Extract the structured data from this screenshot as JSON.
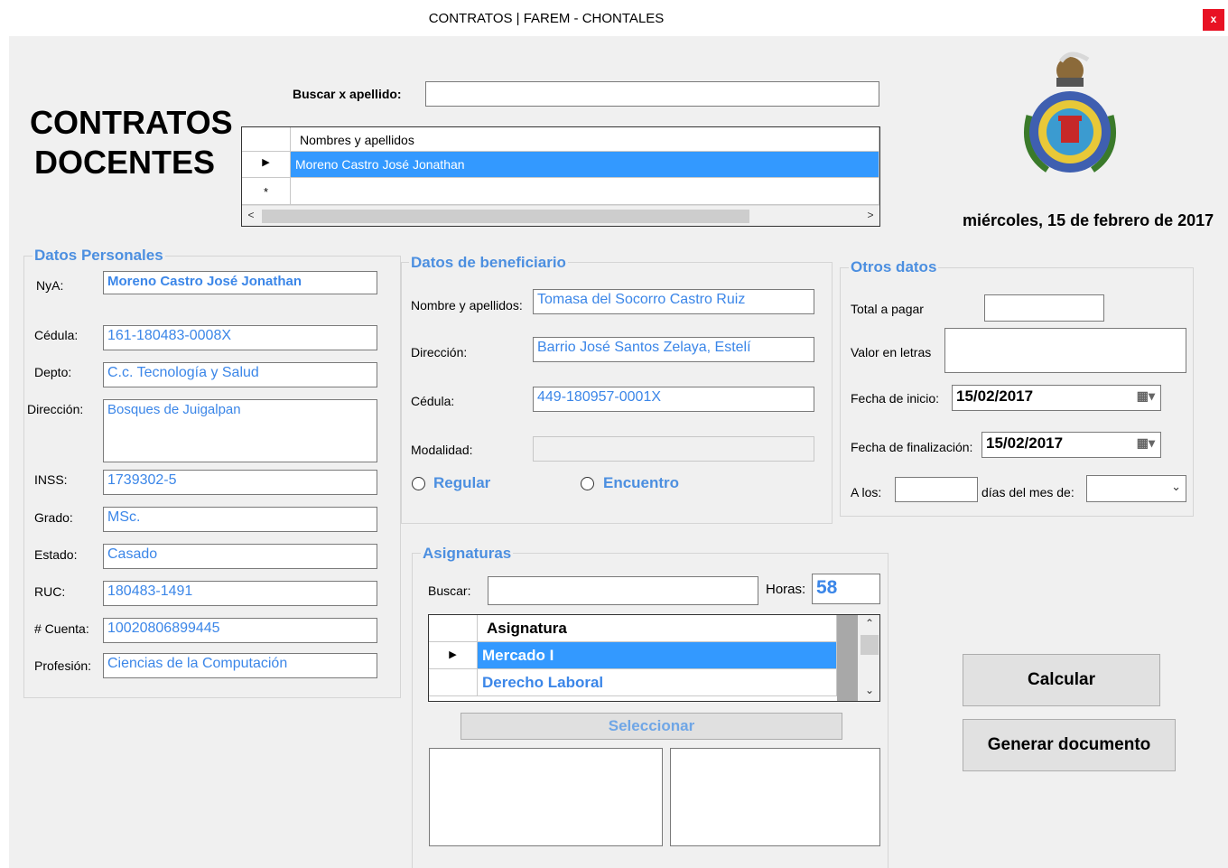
{
  "window": {
    "title": "CONTRATOS |  FAREM - CHONTALES",
    "close_label": "x"
  },
  "header": {
    "title_line1": "CONTRATOS",
    "title_line2": "DOCENTES",
    "date": "miércoles, 15 de febrero de 2017"
  },
  "search": {
    "label": "Buscar x apellido:",
    "value": ""
  },
  "results_grid": {
    "column": "Nombres y apellidos",
    "rows": [
      "Moreno Castro José Jonathan"
    ],
    "new_row_marker": "*",
    "scroll_left": "<",
    "scroll_right": ">"
  },
  "personal": {
    "legend": "Datos Personales",
    "fields": [
      {
        "label": "NyA:",
        "value": "Moreno Castro José Jonathan"
      },
      {
        "label": "Cédula:",
        "value": "161-180483-0008X"
      },
      {
        "label": "Depto:",
        "value": "C.c. Tecnología y Salud"
      },
      {
        "label": "Dirección:",
        "value": "Bosques de Juigalpan"
      },
      {
        "label": "INSS:",
        "value": "1739302-5"
      },
      {
        "label": "Grado:",
        "value": "MSc."
      },
      {
        "label": "Estado:",
        "value": "Casado"
      },
      {
        "label": "RUC:",
        "value": "180483-1491"
      },
      {
        "label": "# Cuenta:",
        "value": "10020806899445"
      },
      {
        "label": "Profesión:",
        "value": "Ciencias de la Computación"
      }
    ]
  },
  "beneficiary": {
    "legend": "Datos de beneficiario",
    "fields": [
      {
        "label": "Nombre y apellidos:",
        "value": "Tomasa del Socorro Castro Ruiz"
      },
      {
        "label": "Dirección:",
        "value": "Barrio José Santos Zelaya, Estelí"
      },
      {
        "label": "Cédula:",
        "value": "449-180957-0001X"
      },
      {
        "label": "Modalidad:",
        "value": ""
      }
    ],
    "radio_regular": "Regular",
    "radio_encuentro": "Encuentro"
  },
  "other": {
    "legend": "Otros datos",
    "total_label": "Total a pagar",
    "total_value": "",
    "letters_label": "Valor en letras",
    "letters_value": "",
    "start_label": "Fecha de inicio:",
    "start_value": "15/02/2017",
    "end_label": "Fecha de finalización:",
    "end_value": "15/02/2017",
    "alos_label": "A los:",
    "alos_value": "",
    "month_label": "días del mes de:",
    "month_value": ""
  },
  "subjects": {
    "legend": "Asignaturas",
    "search_label": "Buscar:",
    "search_value": "",
    "hours_label": "Horas:",
    "hours_value": "58",
    "column": "Asignatura",
    "rows": [
      "Mercado I",
      "Derecho Laboral"
    ],
    "select_label": "Seleccionar"
  },
  "actions": {
    "calculate": "Calcular",
    "generate": "Generar documento"
  }
}
